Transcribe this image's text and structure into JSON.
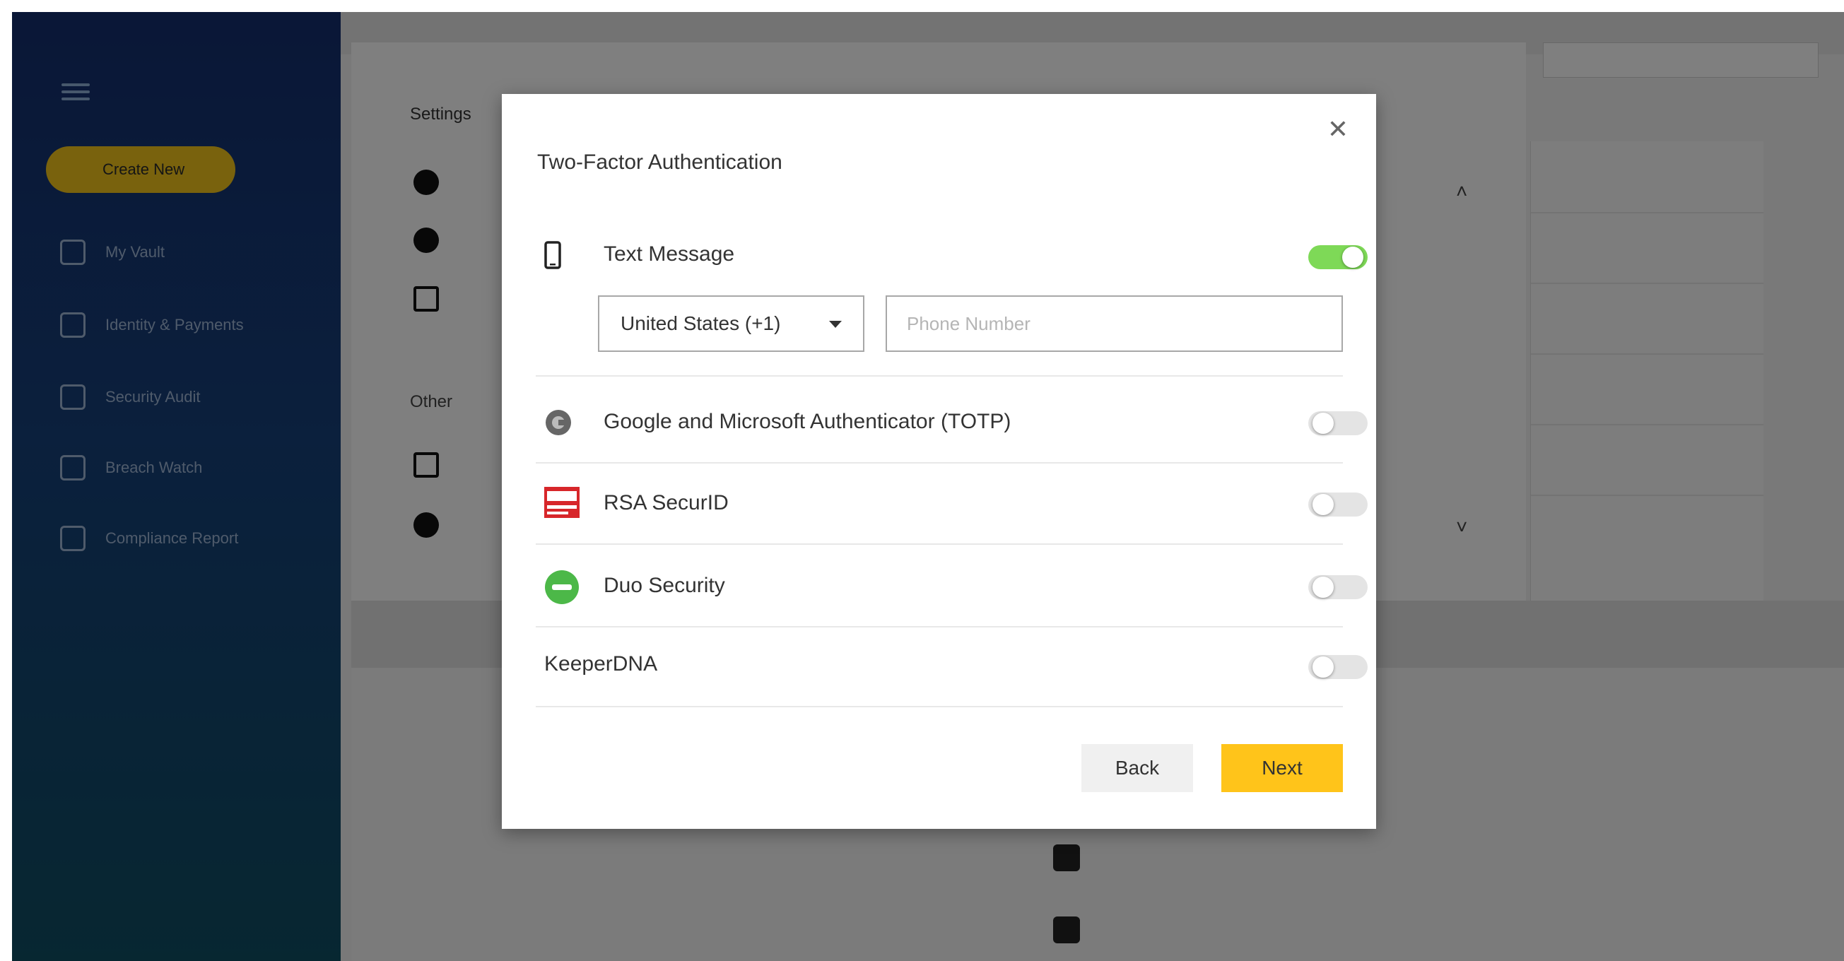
{
  "sidebar": {
    "create_label": "Create New",
    "items": [
      {
        "label": "My Vault"
      },
      {
        "label": "Identity & Payments"
      },
      {
        "label": "Security Audit"
      },
      {
        "label": "Breach Watch"
      },
      {
        "label": "Compliance Report"
      }
    ]
  },
  "settings": {
    "title": "Settings",
    "section_other": "Other"
  },
  "modal": {
    "title": "Two-Factor Authentication",
    "close_glyph": "✕",
    "methods": [
      {
        "label": "Text Message",
        "icon": "smartphone-icon",
        "enabled": true
      },
      {
        "label": "Google and Microsoft Authenticator (TOTP)",
        "icon": "authenticator-icon",
        "enabled": false
      },
      {
        "label": "RSA SecurID",
        "icon": "rsa-logo-icon",
        "enabled": false
      },
      {
        "label": "Duo Security",
        "icon": "duo-logo-icon",
        "enabled": false
      },
      {
        "label": "KeeperDNA",
        "icon": "",
        "enabled": false
      }
    ],
    "country_select": {
      "value": "United States (+1)"
    },
    "phone_input": {
      "placeholder": "Phone Number",
      "value": ""
    },
    "back_label": "Back",
    "next_label": "Next"
  },
  "colors": {
    "accent_yellow": "#ffc41a",
    "toggle_on": "#7ed957",
    "sidebar_top": "#152e6e",
    "sidebar_bottom": "#0f4e63"
  }
}
